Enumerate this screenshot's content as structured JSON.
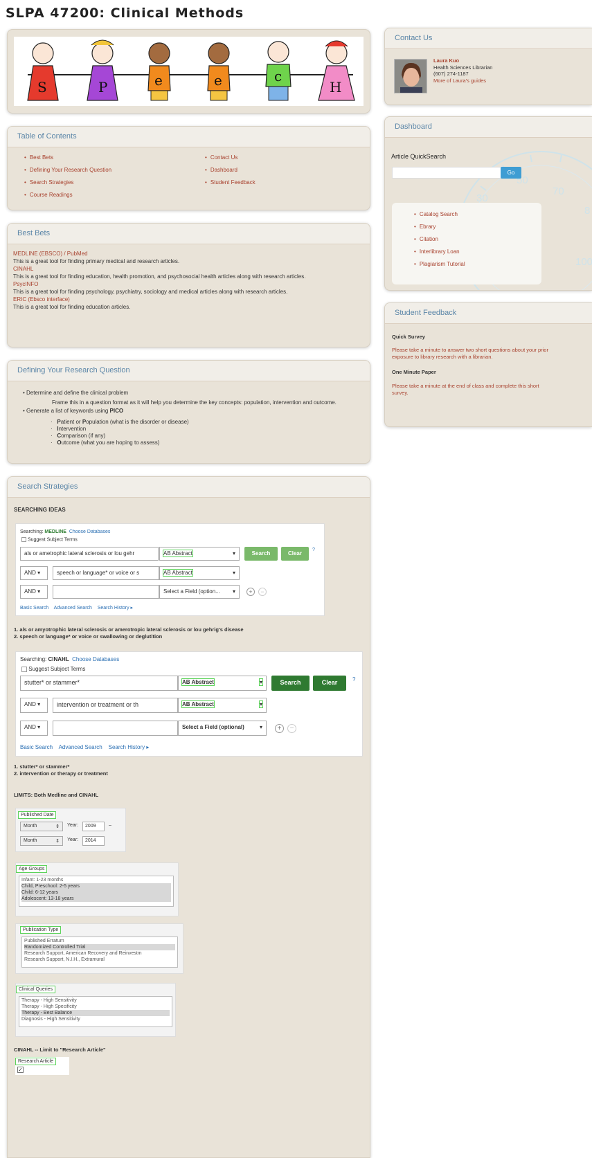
{
  "page": {
    "title": "SLPA 47200: Clinical Methods"
  },
  "banner": {
    "letters": [
      "S",
      "P",
      "e",
      "e",
      "c",
      "H"
    ]
  },
  "toc": {
    "title": "Table of Contents",
    "left": [
      "Best Bets",
      "Defining Your Research Question",
      "Search Strategies",
      "Course Readings"
    ],
    "right": [
      "Contact Us",
      "Dashboard",
      "Student Feedback"
    ]
  },
  "best_bets": {
    "title": "Best Bets",
    "items": [
      {
        "name": "MEDLINE (EBSCO) / PubMed",
        "desc": "This is a great tool for finding primary medical and research articles."
      },
      {
        "name": "CINAHL",
        "desc": "This is a great tool for finding education, health promotion, and psychosocial health articles along with research articles."
      },
      {
        "name": "PsycINFO",
        "desc": "This is a great tool for finding psychology, psychiatry, sociology and medical articles along with research articles."
      },
      {
        "name": "ERIC (Ebsco interface)",
        "desc": "This is a great tool for finding education articles."
      }
    ]
  },
  "research_question": {
    "title": "Defining Your Research Question",
    "b1": "Determine and define the clinical problem",
    "b1_sub": "Frame this in a question format as it will help you determine the key concepts: population, intervention and outcome.",
    "b2_pre": "Generate a list of keywords using ",
    "b2_bold": "PICO",
    "pico": [
      {
        "letter": "P",
        "rest": "atient or ",
        "letter2": "P",
        "rest2": "opulation (what is the disorder or disease)"
      },
      {
        "letter": "I",
        "rest": "ntervention"
      },
      {
        "letter": "C",
        "rest": "omparison (if any)"
      },
      {
        "letter": "O",
        "rest": "utcome (what you are hoping to assess)"
      }
    ]
  },
  "search_strategies": {
    "title": "Search Strategies",
    "heading": "SEARCHING IDEAS",
    "medline": {
      "searching_label": "Searching:",
      "db": "MEDLINE",
      "choose": "Choose Databases",
      "suggest": "Suggest Subject Terms",
      "row1_text": "als or ametrophic lateral sclerosis or lou gehr",
      "row1_field": "AB Abstract",
      "row2_op": "AND",
      "row2_text": "speech or language* or voice or s",
      "row2_field": "AB Abstract",
      "row3_op": "AND",
      "row3_field": "Select a Field (option...",
      "search": "Search",
      "clear": "Clear",
      "links": [
        "Basic Search",
        "Advanced Search",
        "Search History ▸"
      ]
    },
    "medline_notes": [
      "1. als or amyotrophic lateral sclerosis or amerotropic lateral sclerosis or lou gehrig's disease",
      "2. speech or language* or voice or swallowing or deglutition"
    ],
    "cinahl": {
      "searching_label": "Searching:",
      "db": "CINAHL",
      "choose": "Choose Databases",
      "suggest": "Suggest Subject Terms",
      "row1_text": "stutter* or stammer*",
      "row1_field": "AB Abstract",
      "row2_op": "AND",
      "row2_text": "intervention or treatment or th",
      "row2_field": "AB Abstract",
      "row3_op": "AND",
      "row3_field": "Select a Field (optional)",
      "search": "Search",
      "clear": "Clear",
      "links": [
        "Basic Search",
        "Advanced Search",
        "Search History ▸"
      ]
    },
    "cinahl_notes": [
      "1. stutter* or stammer*",
      "2. intervention or therapy or treatment"
    ],
    "limits_heading": "LIMITS: Both Medline and CINAHL",
    "published_date": {
      "label": "Published Date",
      "row1": {
        "month": "Month",
        "year_label": "Year:",
        "year": "2009",
        "dash": "–"
      },
      "row2": {
        "month": "Month",
        "year_label": "Year:",
        "year": "2014"
      }
    },
    "age_groups": {
      "label": "Age Groups",
      "options": [
        "Infant: 1-23 months",
        "Child, Preschool: 2-5 years",
        "Child: 6-12 years",
        "Adolescent: 13-18 years"
      ],
      "selected": [
        1,
        2,
        3
      ]
    },
    "publication_type": {
      "label": "Publication Type",
      "options": [
        "Published Erratum",
        "Randomized Controlled Trial",
        "Research Support, American Recovery and Reinvestm",
        "Research Support, N.I.H., Extramural"
      ],
      "selected": [
        1
      ]
    },
    "clinical_queries": {
      "label": "Clinical Queries",
      "options": [
        "Therapy - High Sensitivity",
        "Therapy - High Specificity",
        "Therapy - Best Balance",
        "Diagnosis - High Sensitivity"
      ],
      "selected": [
        2
      ]
    },
    "cinahl_limit_heading": "CINAHL -- Limit to \"Research Article\"",
    "research_article_label": "Research Article",
    "research_article_check": "✓"
  },
  "contact": {
    "title": "Contact Us",
    "name": "Laura Kuo",
    "role": "Health Sciences Librarian",
    "phone": "(607) 274-1187",
    "more": "More of Laura's guides"
  },
  "dashboard": {
    "title": "Dashboard",
    "quicksearch_label": "Article QuickSearch",
    "go": "Go",
    "gauge_numbers": [
      "50",
      "30",
      "70",
      "8",
      "100"
    ],
    "links": [
      "Catalog Search",
      "Ebrary",
      "Citation",
      "Interlibrary Loan",
      "Plagiarism Tutorial"
    ]
  },
  "feedback": {
    "title": "Student Feedback",
    "survey_title": "Quick Survey",
    "survey_text": "Please take a minute to answer two short questions about your prior exposure to library research with a librarian.",
    "paper_title": "One Minute Paper",
    "paper_text": "Please take a minute at the end of class and complete this short survey."
  }
}
